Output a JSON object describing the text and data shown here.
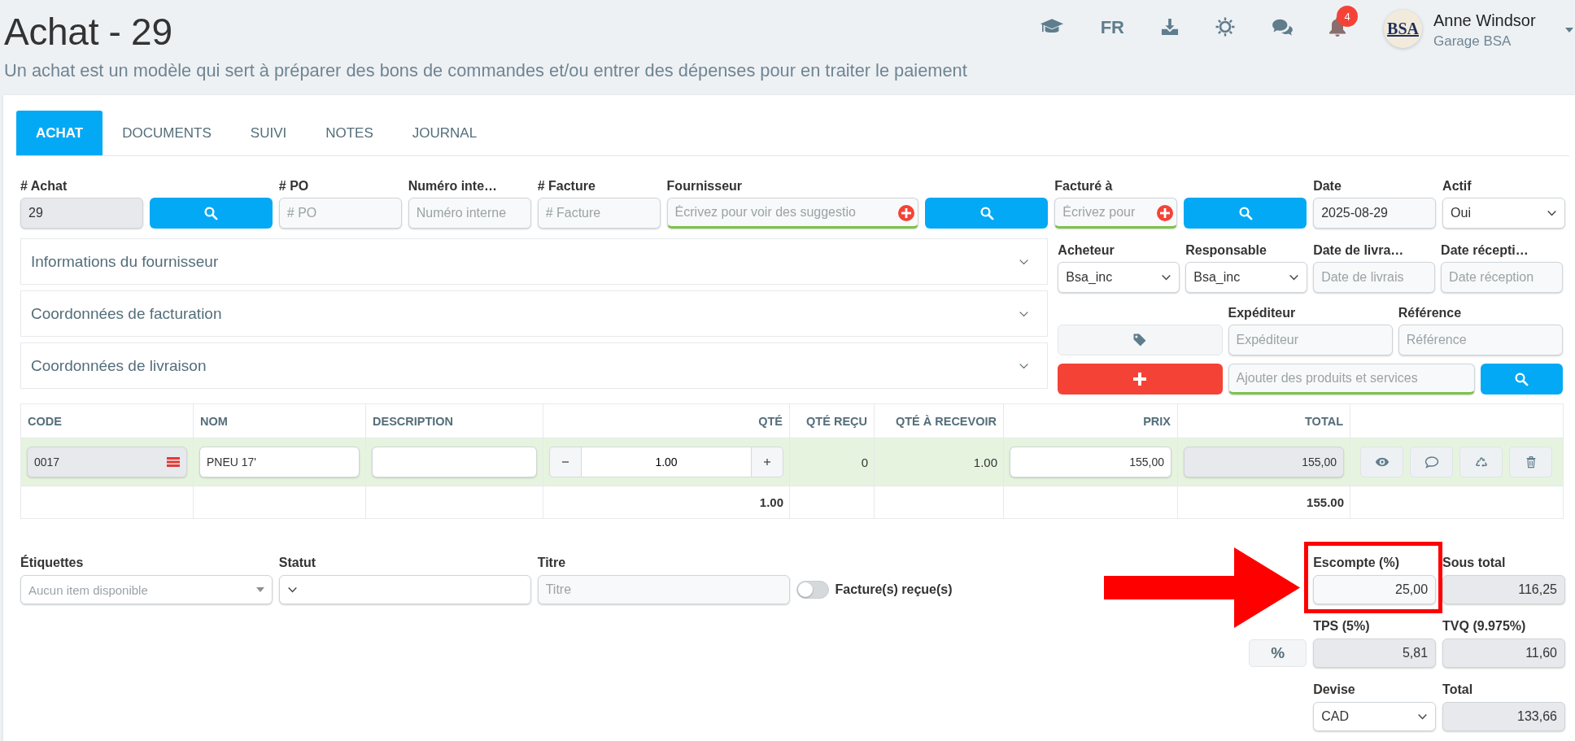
{
  "header": {
    "title": "Achat - 29",
    "subtitle": "Un achat est un modèle qui sert à préparer des bons de commandes et/ou entrer des dépenses pour en traiter le paiement",
    "language": "FR",
    "notification_count": "4",
    "user": {
      "logo": "BSA",
      "name": "Anne Windsor",
      "company": "Garage BSA"
    }
  },
  "tabs": [
    {
      "label": "ACHAT",
      "selected": true
    },
    {
      "label": "DOCUMENTS",
      "selected": false
    },
    {
      "label": "SUIVI",
      "selected": false
    },
    {
      "label": "NOTES",
      "selected": false
    },
    {
      "label": "JOURNAL",
      "selected": false
    }
  ],
  "top_fields": [
    {
      "kind": "input",
      "label": "# Achat",
      "value": "29",
      "disabled": true
    },
    {
      "kind": "search_button"
    },
    {
      "kind": "input",
      "label": "# PO",
      "placeholder": "# PO",
      "disabled": false
    },
    {
      "kind": "input",
      "label": "Numéro inte…",
      "placeholder": "Numéro interne",
      "disabled": false
    },
    {
      "kind": "input",
      "label": "# Facture",
      "placeholder": "# Facture",
      "disabled": false
    },
    {
      "kind": "autocomplete",
      "label": "Fournisseur",
      "placeholder": "Écrivez pour voir des suggestio",
      "can_add": true
    },
    {
      "kind": "search_button"
    },
    {
      "kind": "autocomplete",
      "label": "Facturé à",
      "placeholder": "Écrivez pour",
      "can_add": true
    },
    {
      "kind": "search_button"
    },
    {
      "kind": "input",
      "label": "Date",
      "value": "2025-08-29",
      "disabled": false
    },
    {
      "kind": "select",
      "label": "Actif",
      "value": "Oui"
    }
  ],
  "sections": [
    {
      "title": "Informations du fournisseur",
      "expanded": false
    },
    {
      "title": "Coordonnées de facturation",
      "expanded": false
    },
    {
      "title": "Coordonnées de livraison",
      "expanded": false
    }
  ],
  "side_rows": [
    [
      {
        "kind": "select",
        "label": "Acheteur",
        "value": "Bsa_inc"
      },
      {
        "kind": "select",
        "label": "Responsable",
        "value": "Bsa_inc"
      },
      {
        "kind": "input",
        "label": "Date de livra…",
        "placeholder": "Date de livrais",
        "disabled": false
      },
      {
        "kind": "input",
        "label": "Date récepti…",
        "placeholder": "Date réception",
        "disabled": false
      }
    ],
    [
      {
        "kind": "tag_button"
      },
      {
        "kind": "input",
        "label": "Expéditeur",
        "placeholder": "Expéditeur",
        "disabled": false
      },
      {
        "kind": "input",
        "label": "Référence",
        "placeholder": "Référence",
        "disabled": false
      }
    ],
    [
      {
        "kind": "add_button"
      },
      {
        "kind": "autocomplete",
        "placeholder": "Ajouter des produits et services",
        "can_add": false
      },
      {
        "kind": "search_button"
      }
    ]
  ],
  "table": {
    "columns": [
      "CODE",
      "NOM",
      "DESCRIPTION",
      "QTÉ",
      "QTÉ REÇU",
      "QTÉ À RECEVOIR",
      "PRIX",
      "TOTAL"
    ],
    "rows": [
      {
        "code": "0017",
        "name": "PNEU 17'",
        "qty": "1.00",
        "qty_received": "0",
        "qty_to_receive": "1.00",
        "price": "155,00",
        "total": "155,00"
      }
    ],
    "totals": {
      "qty": "1.00",
      "total": "155.00"
    }
  },
  "details": [
    {
      "kind": "multiselect",
      "label": "Étiquettes",
      "placeholder": "Aucun item disponible"
    },
    {
      "kind": "select",
      "label": "Statut"
    },
    {
      "kind": "input",
      "label": "Titre",
      "placeholder": "Titre",
      "disabled": false
    },
    {
      "kind": "toggle",
      "label": "Facture(s) reçue(s)",
      "on": false
    }
  ],
  "summary": [
    [
      {
        "kind": "amount",
        "label": "Escompte (%)",
        "value": "25,00",
        "disabled": false,
        "highlighted": true
      },
      {
        "kind": "amount",
        "label": "Sous total",
        "value": "116,25",
        "disabled": true
      }
    ],
    [
      {
        "kind": "percent_button",
        "text": "%"
      },
      {
        "kind": "amount",
        "label": "TPS (5%)",
        "value": "5,81",
        "disabled": true
      },
      {
        "kind": "amount",
        "label": "TVQ (9.975%)",
        "value": "11,60",
        "disabled": true
      }
    ],
    [
      {
        "kind": "select",
        "label": "Devise",
        "value": "CAD"
      },
      {
        "kind": "amount",
        "label": "Total",
        "value": "133,66",
        "disabled": true
      }
    ]
  ]
}
